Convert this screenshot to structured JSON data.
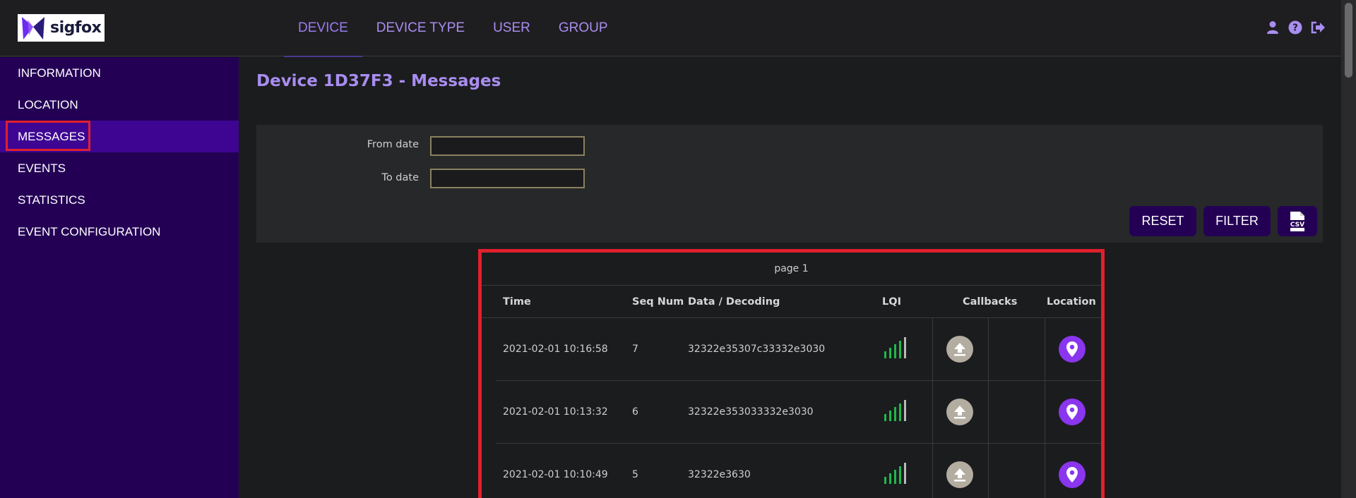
{
  "brand": {
    "name": "sigfox"
  },
  "topnav": {
    "items": [
      "DEVICE",
      "DEVICE TYPE",
      "USER",
      "GROUP"
    ]
  },
  "sidebar": {
    "items": [
      "INFORMATION",
      "LOCATION",
      "MESSAGES",
      "EVENTS",
      "STATISTICS",
      "EVENT CONFIGURATION"
    ]
  },
  "page": {
    "title": "Device 1D37F3 - Messages"
  },
  "filters": {
    "from_label": "From date",
    "from_value": "",
    "to_label": "To date",
    "to_value": "",
    "reset_label": "RESET",
    "filter_label": "FILTER",
    "csv_label": "CSV"
  },
  "table": {
    "page_label": "page 1",
    "headers": {
      "time": "Time",
      "seq": "Seq Num",
      "data": "Data / Decoding",
      "lqi": "LQI",
      "callbacks": "Callbacks",
      "location": "Location"
    },
    "rows": [
      {
        "time": "2021-02-01 10:16:58",
        "seq": "7",
        "data": "32322e35307c33332e3030"
      },
      {
        "time": "2021-02-01 10:13:32",
        "seq": "6",
        "data": "32322e353033332e3030"
      },
      {
        "time": "2021-02-01 10:10:49",
        "seq": "5",
        "data": "32322e3630"
      }
    ]
  },
  "colors": {
    "accent": "#a98df0",
    "sidebar": "#240055",
    "sidebar_active": "#3e0592",
    "highlight": "#e0202e",
    "lqi": "#1fb84a",
    "location": "#8a35ee"
  },
  "icons": [
    "user-icon",
    "help-icon",
    "logout-icon",
    "csv-file-icon",
    "upload-icon",
    "map-pin-icon",
    "signal-bars-icon"
  ]
}
